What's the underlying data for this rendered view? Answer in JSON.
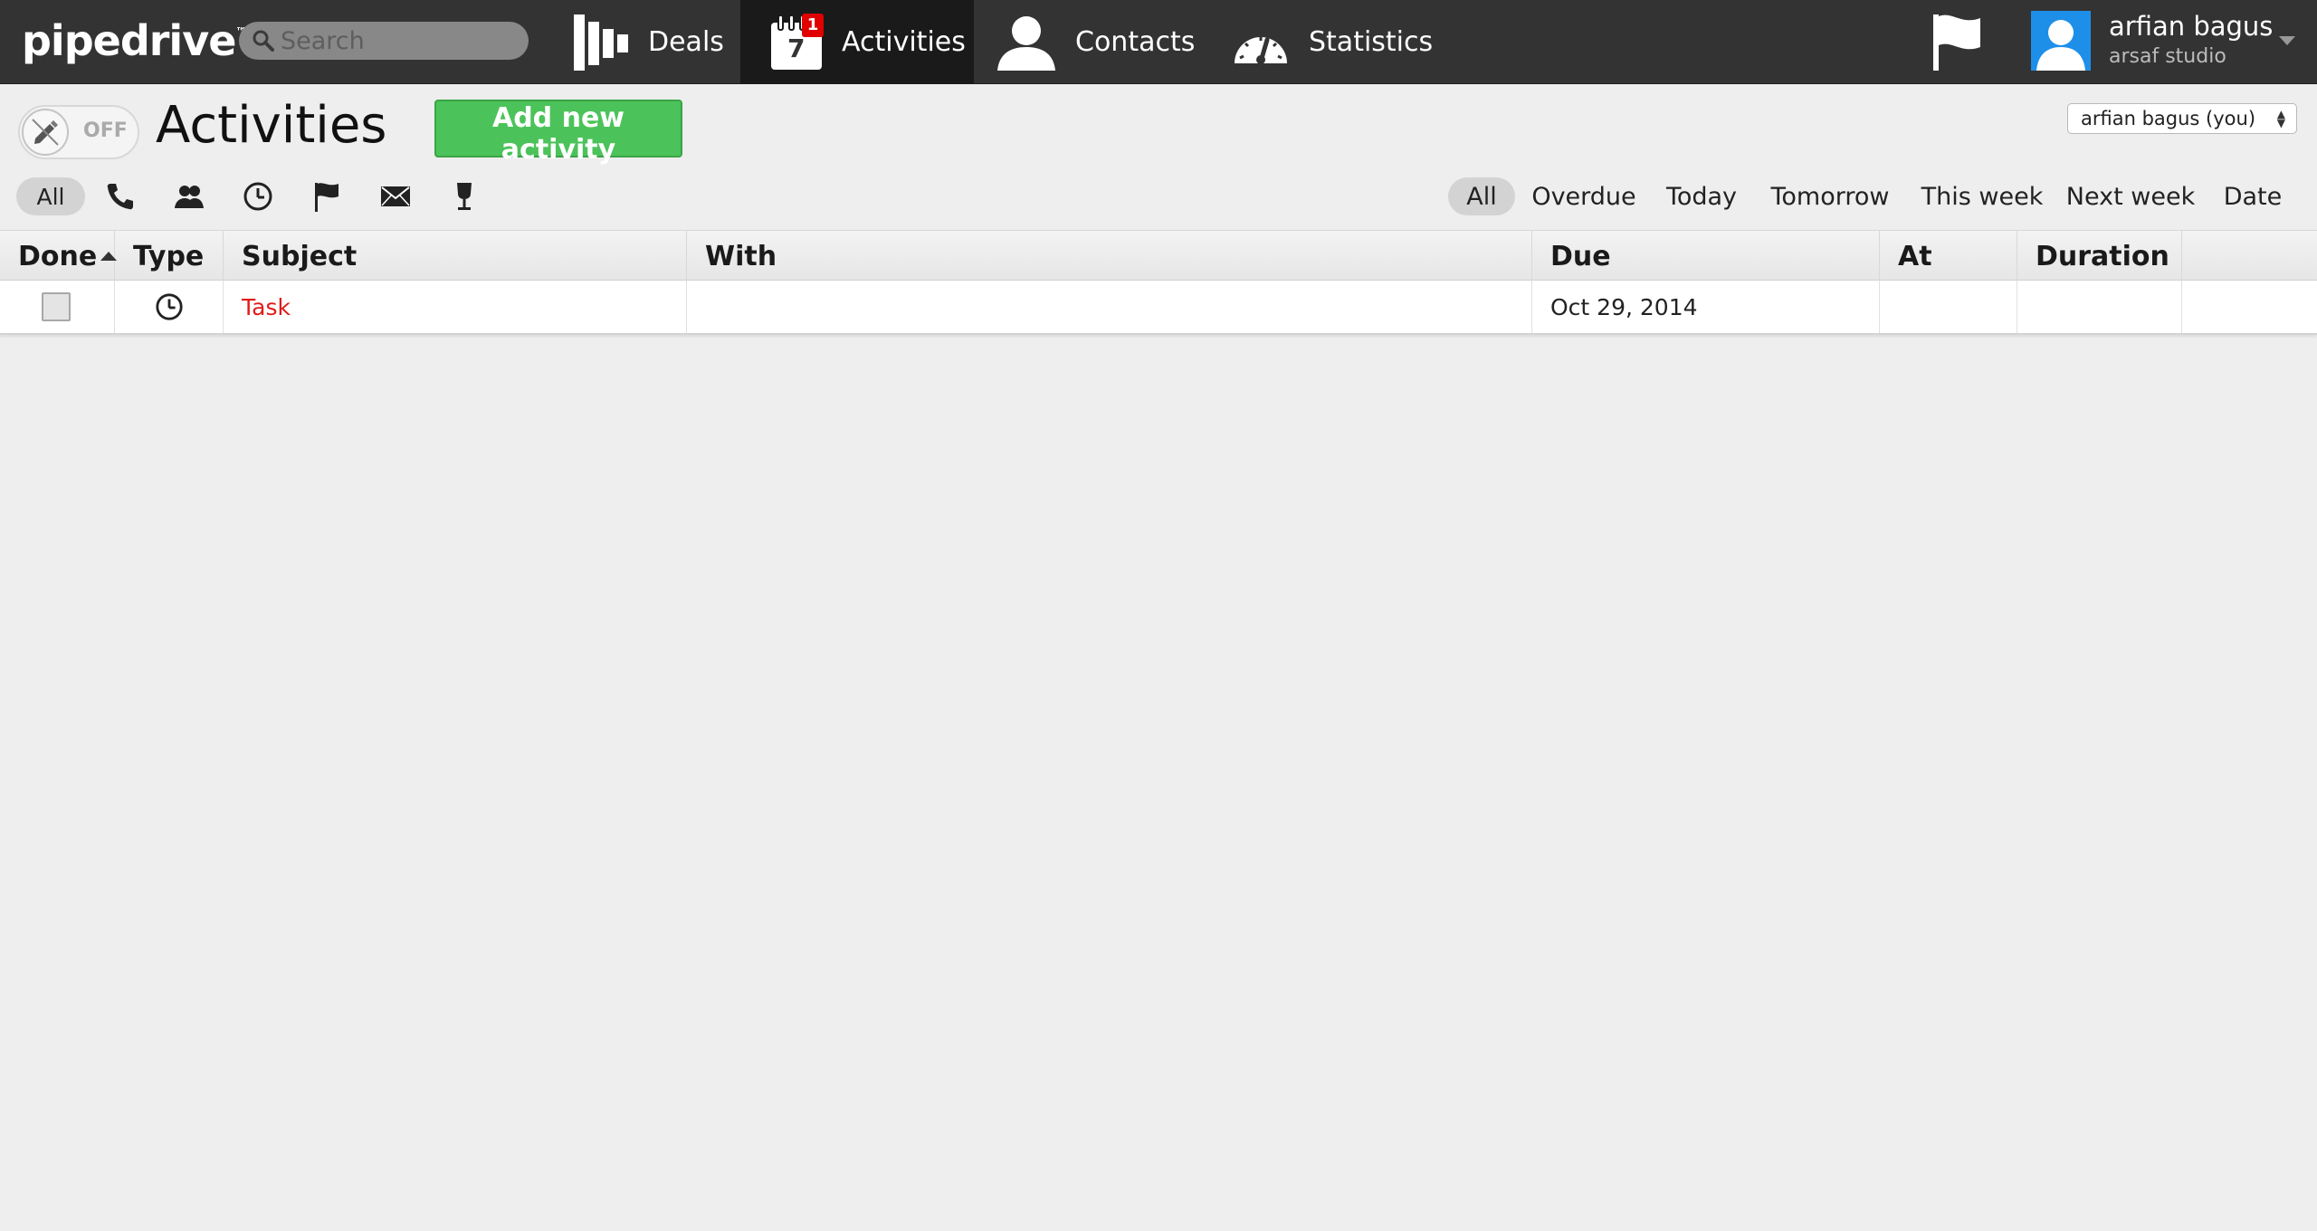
{
  "app": {
    "logo": "pipedrive",
    "logo_mark": "™"
  },
  "search": {
    "placeholder": "Search"
  },
  "nav": {
    "deals": "Deals",
    "activities": "Activities",
    "activities_badge": "1",
    "calendar_day": "7",
    "contacts": "Contacts",
    "statistics": "Statistics"
  },
  "user": {
    "name": "arfian bagus",
    "company": "arsaf studio"
  },
  "header": {
    "toggle_label": "OFF",
    "title": "Activities",
    "add_button": "Add new activity",
    "owner_selected": "arfian bagus (you)"
  },
  "type_filters": {
    "all": "All",
    "icons": [
      "phone-icon",
      "meeting-icon",
      "task-clock-icon",
      "deadline-flag-icon",
      "email-icon",
      "lunch-glass-icon"
    ]
  },
  "date_filters": [
    "All",
    "Overdue",
    "Today",
    "Tomorrow",
    "This week",
    "Next week",
    "Date"
  ],
  "table": {
    "columns": [
      "Done",
      "Type",
      "Subject",
      "With",
      "Due",
      "At",
      "Duration"
    ],
    "rows": [
      {
        "done": false,
        "type_icon": "task-clock-icon",
        "subject": "Task",
        "with": "",
        "due": "Oct 29, 2014",
        "at": "",
        "duration": ""
      }
    ]
  },
  "colors": {
    "topbar": "#333333",
    "active_nav": "#1a1a1a",
    "add_button": "#4cc35a",
    "badge": "#e00000",
    "subject_link": "#e01b1b",
    "avatar": "#1e8fe8"
  }
}
